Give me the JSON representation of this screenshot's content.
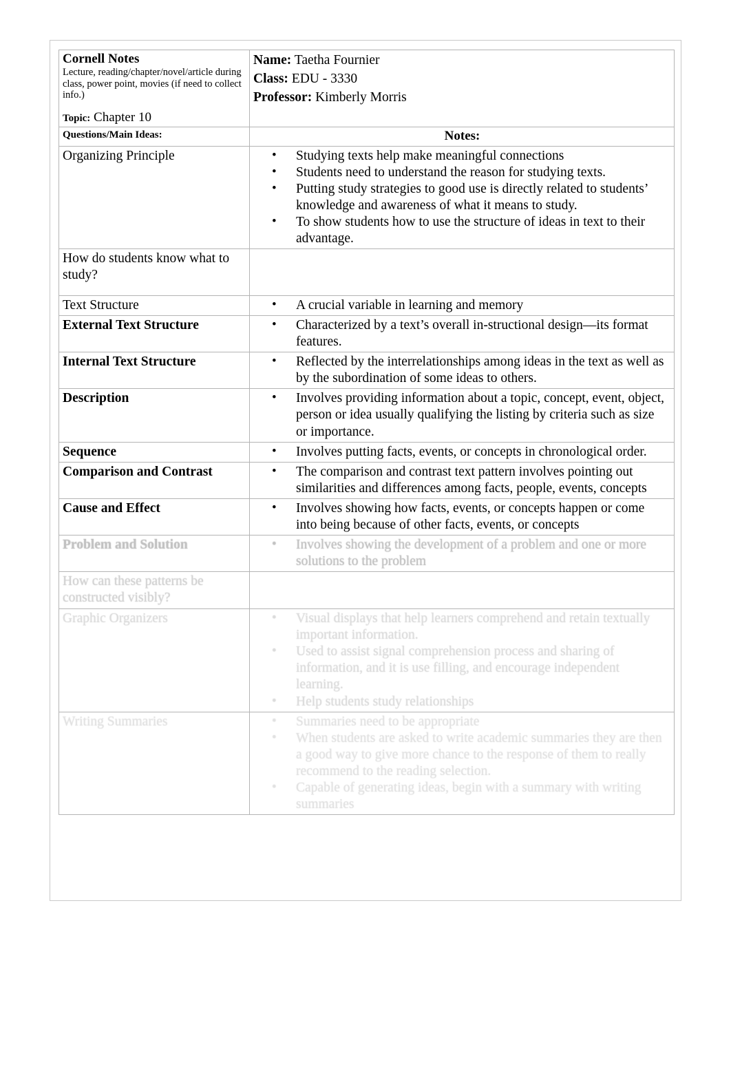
{
  "document": {
    "title": "Cornell Notes",
    "subtitle": "Lecture, reading/chapter/novel/article during class, power point, movies (if need to collect info.)",
    "topic_label": "Topic:",
    "topic_value": "Chapter 10"
  },
  "meta": {
    "name_label": "Name:",
    "name_value": "Taetha Fournier",
    "class_label": "Class:",
    "class_value": "EDU - 3330",
    "professor_label": "Professor:",
    "professor_value": "Kimberly Morris"
  },
  "columns": {
    "questions_header": "Questions/Main Ideas:",
    "notes_header": "Notes:"
  },
  "rows": [
    {
      "question": "Organizing Principle",
      "bold": false,
      "fade": 0,
      "notes": [
        "Studying texts help make meaningful connections",
        "Students need to understand the reason for studying texts.",
        " Putting study strategies to good use is directly related to students’ knowledge and awareness of what it means to study.",
        " To show students how to use the structure of ideas in text to their advantage."
      ]
    },
    {
      "question": "How do students know what to study?",
      "bold": false,
      "fade": 0,
      "notes": []
    },
    {
      "question": "Text Structure",
      "bold": false,
      "fade": 0,
      "notes": [
        "A crucial variable in learning and memory"
      ]
    },
    {
      "question": "External Text Structure",
      "bold": true,
      "fade": 0,
      "notes": [
        "Characterized by a text’s overall in-structional design—its format features."
      ]
    },
    {
      "question": "Internal Text Structure",
      "bold": true,
      "fade": 0,
      "notes": [
        "Reflected by the interrelationships among ideas in the text as well as by the subordination of some ideas to others."
      ]
    },
    {
      "question": "Description",
      "bold": true,
      "fade": 0,
      "notes": [
        "Involves providing information about a topic, concept, event, object, person or idea usually qualifying the listing by criteria such as size or importance."
      ]
    },
    {
      "question": "Sequence",
      "bold": true,
      "fade": 0,
      "notes": [
        "Involves putting facts, events, or concepts in chronological order."
      ]
    },
    {
      "question": "Comparison and Contrast",
      "bold": true,
      "fade": 0,
      "notes": [
        "The comparison and contrast text pattern involves pointing out similarities and differences among facts, people, events, concepts"
      ]
    },
    {
      "question": "Cause and Effect",
      "bold": true,
      "fade": 0,
      "notes": [
        "Involves showing how facts, events, or concepts happen or come into being because of other facts, events, or concepts"
      ]
    },
    {
      "question": "Problem and Solution",
      "bold": true,
      "fade": 1,
      "notes": [
        "Involves showing the development of a problem and one or more solutions to the problem"
      ]
    },
    {
      "question": "How can these patterns be constructed visibly?",
      "bold": false,
      "fade": 2,
      "notes": []
    },
    {
      "question": "Graphic Organizers",
      "bold": false,
      "fade": 3,
      "notes": [
        "Visual displays that help learners comprehend and retain textually important information.",
        "Used to assist signal comprehension process and sharing of information, and it is use filling, and encourage independent learning.",
        "Help students study relationships"
      ]
    },
    {
      "question": "Writing Summaries",
      "bold": false,
      "fade": 4,
      "notes": [
        "Summaries need to be appropriate",
        "When students are asked to write academic summaries they are then a good way to give more chance to the response of them to really recommend to the reading selection.",
        "Capable of generating ideas, begin with a summary with writing summaries"
      ]
    }
  ]
}
